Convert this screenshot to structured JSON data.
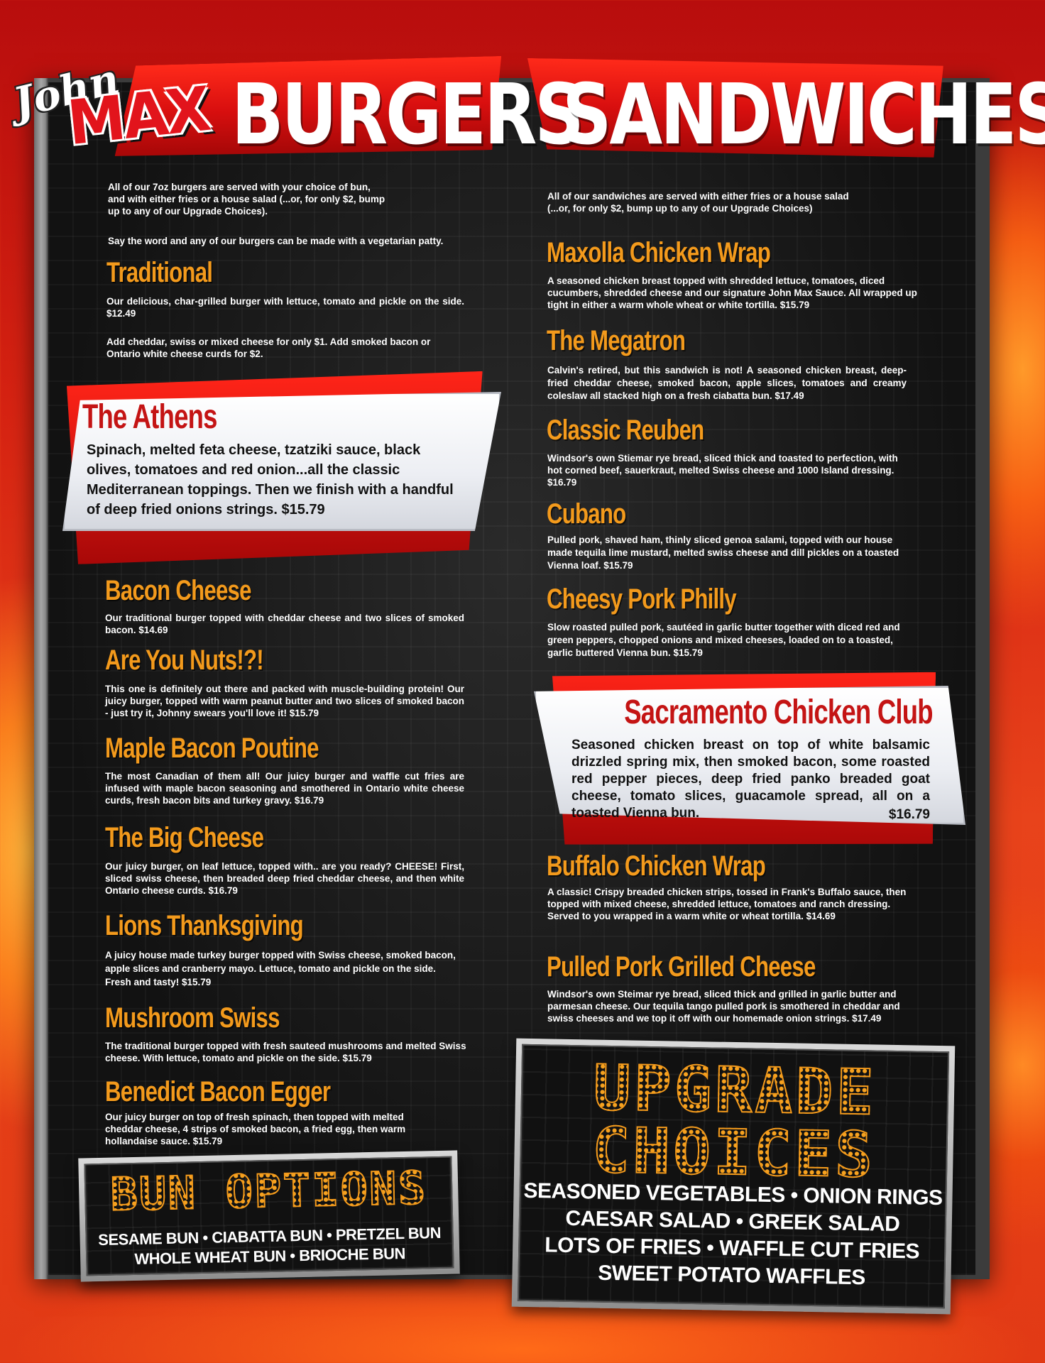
{
  "brand": {
    "logo_top": "John",
    "logo_main": "MAX"
  },
  "burgers": {
    "heading": "BURGERS",
    "intro_lines": [
      "All of our 7oz burgers are served with your choice of bun,",
      "and with either fries or a house salad (...or, for only $2, bump",
      "up to any of our Upgrade Choices)."
    ],
    "veg_note": "Say the word and any of our burgers can be made with a vegetarian patty.",
    "traditional": {
      "name": "Traditional",
      "desc": "Our delicious, char-grilled burger with lettuce, tomato and pickle on the side. $12.49",
      "addon": "Add cheddar, swiss or mixed cheese for only $1. Add smoked bacon or Ontario white cheese curds for $2."
    },
    "featured": {
      "name": "The Athens",
      "desc": "Spinach, melted feta cheese, tzatziki sauce, black olives, tomatoes and red onion...all the classic Mediterranean toppings. Then we finish with a handful of deep fried onions strings. $15.79"
    },
    "items": [
      {
        "name": "Bacon Cheese",
        "desc": "Our traditional burger topped with cheddar cheese and two slices of smoked bacon. $14.69"
      },
      {
        "name": "Are You Nuts!?!",
        "desc": "This one is definitely out there and packed with muscle-building protein! Our juicy burger, topped with warm peanut butter and two slices of smoked bacon - just try it, Johnny swears you'll love it! $15.79"
      },
      {
        "name": "Maple Bacon Poutine",
        "desc": "The most Canadian of them all! Our juicy burger and waffle cut fries are infused with maple bacon seasoning and smothered in Ontario white cheese curds, fresh bacon bits and turkey gravy. $16.79"
      },
      {
        "name": "The Big Cheese",
        "desc": "Our juicy burger, on leaf lettuce, topped with.. are you ready? CHEESE! First, sliced swiss cheese, then breaded deep fried cheddar cheese, and then white Ontario cheese curds. $16.79"
      },
      {
        "name": "Lions Thanksgiving",
        "desc": "A juicy house made turkey burger topped with Swiss cheese, smoked bacon, apple slices and cranberry mayo. Lettuce, tomato and pickle on the side. Fresh and tasty! $15.79"
      },
      {
        "name": "Mushroom Swiss",
        "desc": "The traditional burger topped with fresh sauteed mushrooms and melted Swiss cheese. With lettuce, tomato and pickle on the side. $15.79"
      },
      {
        "name": "Benedict Bacon Egger",
        "desc": "Our juicy burger on top of fresh spinach, then topped with melted cheddar cheese, 4 strips of smoked bacon, a fried egg, then warm hollandaise sauce. $15.79"
      }
    ]
  },
  "sandwiches": {
    "heading": "SANDWICHES",
    "intro_lines": [
      "All of our sandwiches are served with either fries or a house salad",
      "(...or, for only $2, bump up to any of our Upgrade Choices)"
    ],
    "items": [
      {
        "name": "Maxolla Chicken Wrap",
        "desc": "A seasoned chicken breast topped with shredded lettuce, tomatoes, diced cucumbers, shredded cheese and our signature John Max Sauce. All wrapped up tight in either a warm whole wheat or white tortilla. $15.79"
      },
      {
        "name": "The Megatron",
        "desc": "Calvin's retired, but this sandwich is not! A seasoned chicken breast, deep-fried cheddar cheese, smoked bacon, apple slices, tomatoes and creamy coleslaw all stacked high on a fresh ciabatta bun. $17.49"
      },
      {
        "name": "Classic Reuben",
        "desc": "Windsor's own Stiemar rye bread, sliced thick and toasted to perfection, with hot corned beef, sauerkraut, melted Swiss cheese and 1000 Island dressing. $16.79"
      },
      {
        "name": "Cubano",
        "desc": "Pulled pork, shaved ham, thinly sliced genoa salami, topped with our house made tequila lime mustard, melted swiss cheese and dill pickles on a toasted Vienna loaf. $15.79"
      },
      {
        "name": "Cheesy Pork Philly",
        "desc": "Slow roasted pulled pork, sautéed in garlic butter together with diced red and green peppers, chopped onions and mixed cheeses, loaded on to a toasted, garlic buttered Vienna bun. $15.79"
      }
    ],
    "featured": {
      "name": "Sacramento Chicken Club",
      "desc": "Seasoned chicken breast on top of white balsamic drizzled spring mix, then smoked bacon, some roasted red pepper pieces, deep fried panko breaded goat cheese, tomato slices, guacamole spread, all on a toasted Vienna bun.",
      "price": "$16.79"
    },
    "items2": [
      {
        "name": "Buffalo Chicken Wrap",
        "desc": "A classic! Crispy breaded chicken strips, tossed in Frank's Buffalo sauce, then topped with mixed cheese, shredded lettuce, tomatoes and ranch dressing. Served to you wrapped in a warm white or wheat tortilla. $14.69"
      },
      {
        "name": "Pulled Pork Grilled Cheese",
        "desc": "Windsor's own Steimar rye bread, sliced thick and grilled in garlic butter and parmesan cheese. Our tequila tango pulled pork is smothered in cheddar and swiss cheeses and we top it off with our homemade onion strings. $17.49"
      }
    ]
  },
  "bun_options": {
    "title": "BUN OPTIONS",
    "line1": "SESAME BUN • CIABATTA BUN • PRETZEL BUN",
    "line2": "WHOLE WHEAT BUN • BRIOCHE BUN"
  },
  "upgrade_choices": {
    "title_line1": "UPGRADE",
    "title_line2": "CHOICES",
    "lines": [
      "SEASONED VEGETABLES • ONION RINGS",
      "CAESAR SALAD • GREEK SALAD",
      "LOTS OF FRIES • WAFFLE CUT FRIES",
      "SWEET POTATO WAFFLES"
    ]
  },
  "colors": {
    "accent_orange": "#f39a1c",
    "brand_red": "#d90f0f",
    "feature_title_red": "#c41414"
  }
}
